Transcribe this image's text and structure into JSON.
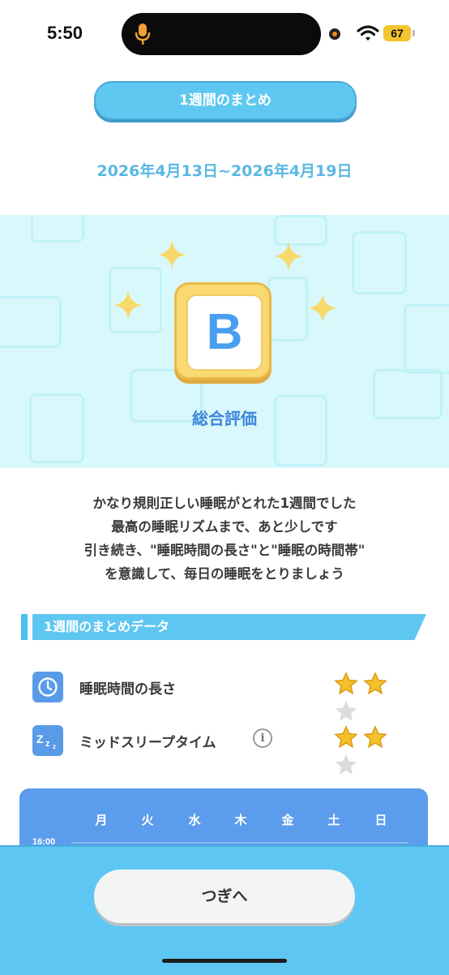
{
  "status_bar": {
    "time": "5:50",
    "battery": "67"
  },
  "header": {
    "title": "1週間のまとめ",
    "date_range": "2026年4月13日~2026年4月19日"
  },
  "evaluation": {
    "grade": "B",
    "label": "総合評価"
  },
  "message": {
    "lines": [
      "かなり規則正しい睡眠がとれた1週間でした",
      "最高の睡眠リズムまで、あと少しです",
      "引き続き、\"睡眠時間の長さ\"と\"睡眠の時間帯\"",
      "を意識して、毎日の睡眠をとりましょう"
    ]
  },
  "summary_section": {
    "title": "1週間のまとめデータ",
    "rows": [
      {
        "label": "睡眠時間の長さ",
        "icon": "clock-icon",
        "stars": 2,
        "max_stars": 3
      },
      {
        "label": "ミッドスリープタイム",
        "icon": "zzz-icon",
        "stars": 2,
        "max_stars": 3,
        "info_icon": "i"
      }
    ]
  },
  "chart": {
    "days": [
      "月",
      "火",
      "水",
      "木",
      "金",
      "土",
      "日"
    ],
    "first_hour_label": "16:00"
  },
  "footer": {
    "next_label": "つぎへ"
  },
  "colors": {
    "accent": "#5ec6f2",
    "date_text": "#5ab8e3",
    "grade_text": "#4a9ef0",
    "chart_bg": "#5c9cec",
    "star_filled": "#f5c02a",
    "star_empty": "#d9d9d9"
  }
}
